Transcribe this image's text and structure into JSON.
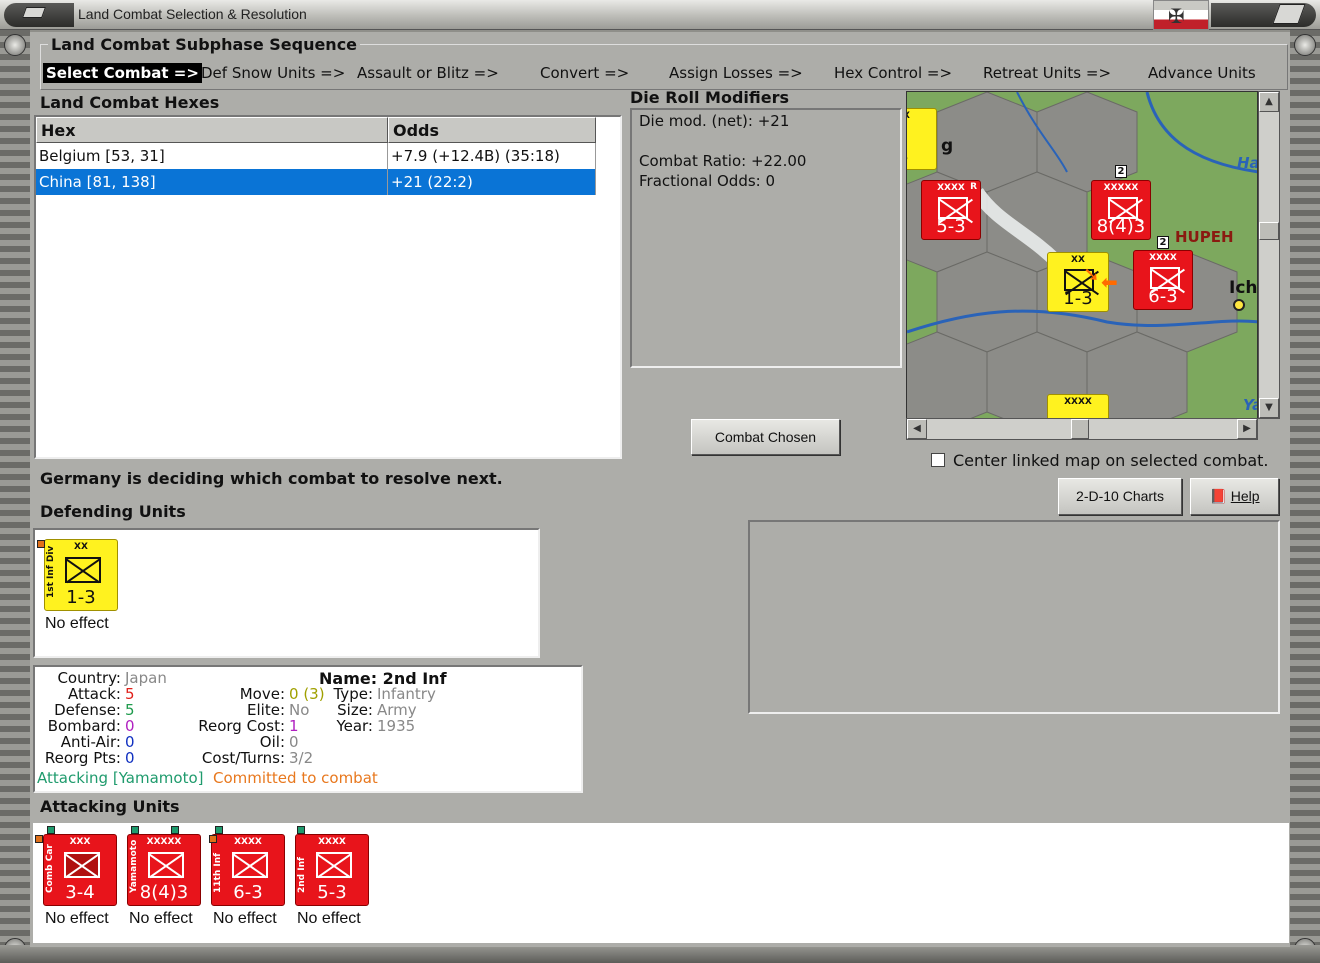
{
  "window": {
    "title": "Land Combat Selection & Resolution"
  },
  "sequence": {
    "title": "Land Combat Subphase Sequence",
    "steps": [
      "Select Combat =>",
      "Def Snow Units =>",
      "Assault or Blitz =>",
      "Convert =>",
      "Assign Losses =>",
      "Hex Control =>",
      "Retreat Units =>",
      "Advance Units"
    ]
  },
  "hexes": {
    "title": "Land Combat Hexes",
    "columns": [
      "Hex",
      "Odds"
    ],
    "rows": [
      {
        "hex": "Belgium [53, 31]",
        "odds": "+7.9 (+12.4B) (35:18)"
      },
      {
        "hex": "China [81, 138]",
        "odds": "+21 (22:2)"
      }
    ]
  },
  "die_roll": {
    "title": "Die Roll Modifiers",
    "lines": [
      "Die mod. (net): +21",
      "Combat Ratio: +22.00",
      "Fractional Odds: 0"
    ]
  },
  "map": {
    "labels": [
      "HUPEH",
      "Ha",
      "Ich",
      "Ya",
      "g"
    ],
    "counters": [
      {
        "size": "XXXX",
        "value": "5-3",
        "side": "R"
      },
      {
        "size": "XXXXX",
        "value": "8(4)3",
        "stack": "2"
      },
      {
        "size": "XX",
        "value": "1-3",
        "name": "1st Inf Div"
      },
      {
        "size": "XXXX",
        "value": "6-3",
        "name": "11th Inf",
        "stack": "2"
      },
      {
        "size": "XX",
        "value": "3"
      },
      {
        "size": "XXXX",
        "value": ""
      }
    ]
  },
  "buttons": {
    "combat_chosen": "Combat Chosen",
    "charts": "2-D-10 Charts",
    "help": "Help"
  },
  "center_map_label": "Center linked map on selected combat.",
  "status_message": "Germany is deciding which combat to resolve next.",
  "defending": {
    "title": "Defending Units",
    "units": [
      {
        "name": "1st Inf Div",
        "size": "XX",
        "value": "1-3",
        "effect": "No effect"
      }
    ]
  },
  "unit_info": {
    "country_label": "Country:",
    "country": "Japan",
    "attack_label": "Attack:",
    "attack": "5",
    "defense_label": "Defense:",
    "defense": "5",
    "bombard_label": "Bombard:",
    "bombard": "0",
    "antiair_label": "Anti-Air:",
    "antiair": "0",
    "reorg_pts_label": "Reorg Pts:",
    "reorg_pts": "0",
    "move_label": "Move:",
    "move": "0",
    "move_extra": "(3)",
    "elite_label": "Elite:",
    "elite": "No",
    "reorg_cost_label": "Reorg Cost:",
    "reorg_cost": "1",
    "oil_label": "Oil:",
    "oil": "0",
    "cost_turns_label": "Cost/Turns:",
    "cost_turns": "3/2",
    "name_line": "Name: 2nd Inf",
    "type_label": "Type:",
    "type": "Infantry",
    "size_label": "Size:",
    "size": "Army",
    "year_label": "Year:",
    "year": "1935",
    "attacking_text": "Attacking [Yamamoto]",
    "committed_text": "Committed to combat"
  },
  "attacking": {
    "title": "Attacking Units",
    "units": [
      {
        "name": "Comb Car",
        "size": "XXX",
        "value": "3-4",
        "effect": "No effect"
      },
      {
        "name": "Yamamoto",
        "size": "XXXXX",
        "value": "8(4)3",
        "effect": "No effect"
      },
      {
        "name": "11th Inf",
        "size": "XXXX",
        "value": "6-3",
        "effect": "No effect"
      },
      {
        "name": "2nd Inf",
        "size": "XXXX",
        "value": "5-3",
        "effect": "No effect"
      }
    ]
  },
  "colors": {
    "selection": "#0a74d6",
    "allied_red": "#e8141b",
    "japan_yellow": "#fff21f",
    "attacking_green": "#1f9b6d",
    "committed_orange": "#e8781e"
  }
}
